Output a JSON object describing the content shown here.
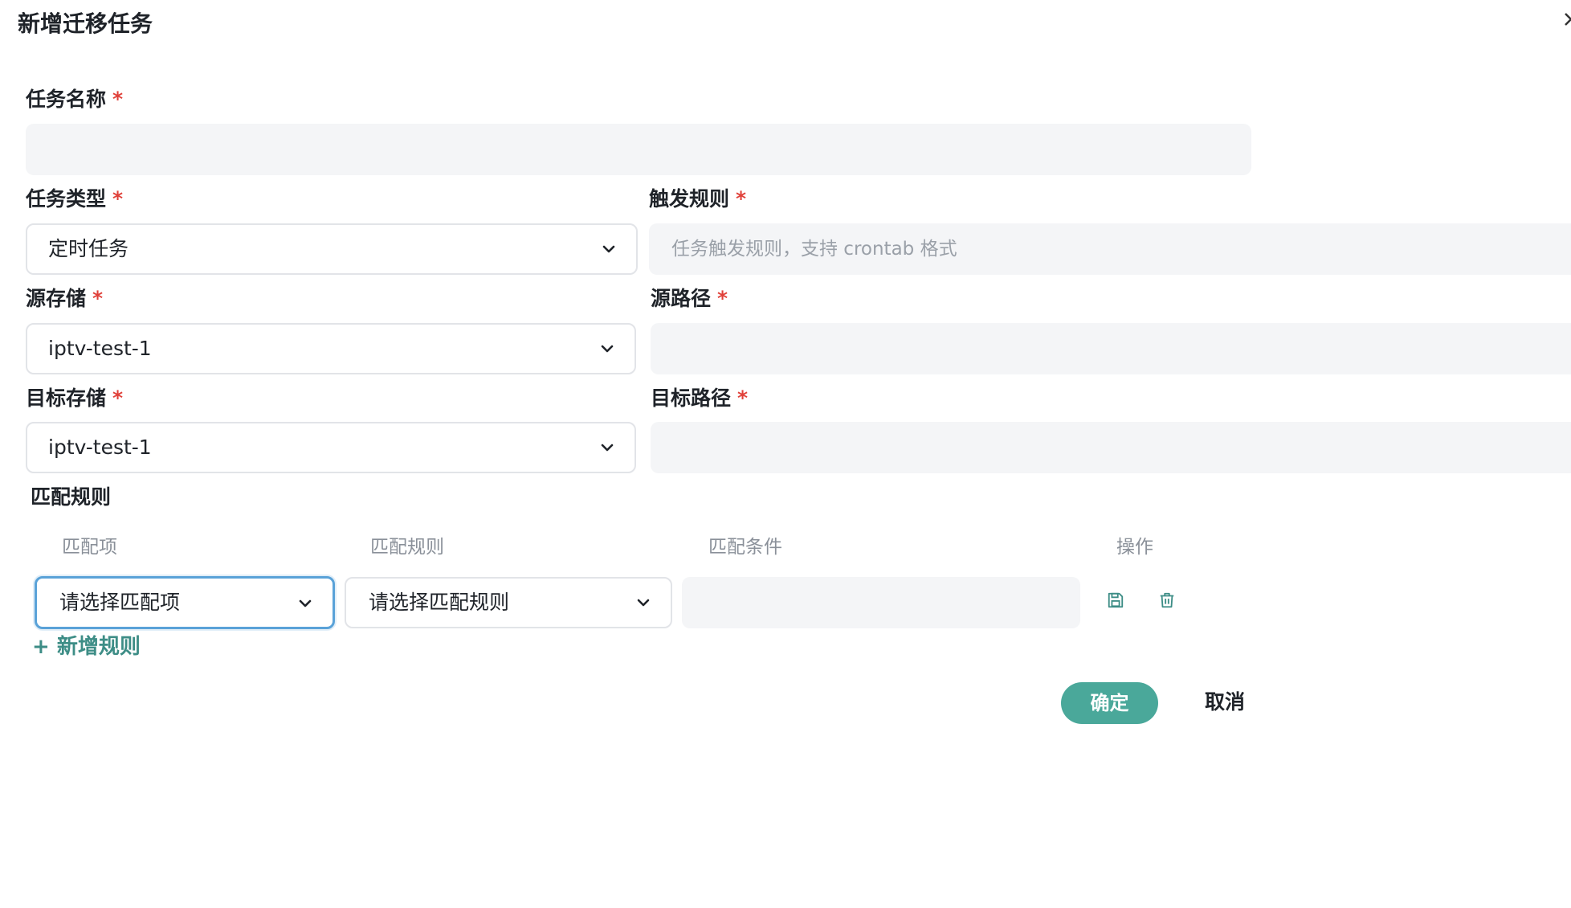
{
  "dialog": {
    "title": "新增迁移任务"
  },
  "form": {
    "task_name": {
      "label": "任务名称",
      "required": "*",
      "value": ""
    },
    "task_type": {
      "label": "任务类型",
      "required": "*",
      "value": "定时任务"
    },
    "trigger_rule": {
      "label": "触发规则",
      "required": "*",
      "placeholder": "任务触发规则，支持 crontab 格式"
    },
    "source_storage": {
      "label": "源存储",
      "required": "*",
      "value": "iptv-test-1"
    },
    "source_path": {
      "label": "源路径",
      "required": "*",
      "value": ""
    },
    "target_storage": {
      "label": "目标存储",
      "required": "*",
      "value": "iptv-test-1"
    },
    "target_path": {
      "label": "目标路径",
      "required": "*",
      "value": ""
    }
  },
  "match_rules": {
    "section_title": "匹配规则",
    "columns": [
      "匹配项",
      "匹配规则",
      "匹配条件",
      "操作"
    ],
    "row": {
      "match_item_placeholder": "请选择匹配项",
      "match_rule_placeholder": "请选择匹配规则",
      "match_condition": "",
      "actions": [
        "save-icon",
        "trash-icon"
      ]
    },
    "add_label": "+ 新增规则"
  },
  "footer": {
    "confirm_label": "确定",
    "cancel_label": "取消"
  },
  "colors": {
    "accent": "#4aa89a",
    "link": "#3d8d86",
    "required": "#e0413a",
    "focus": "#5aa2d8"
  }
}
